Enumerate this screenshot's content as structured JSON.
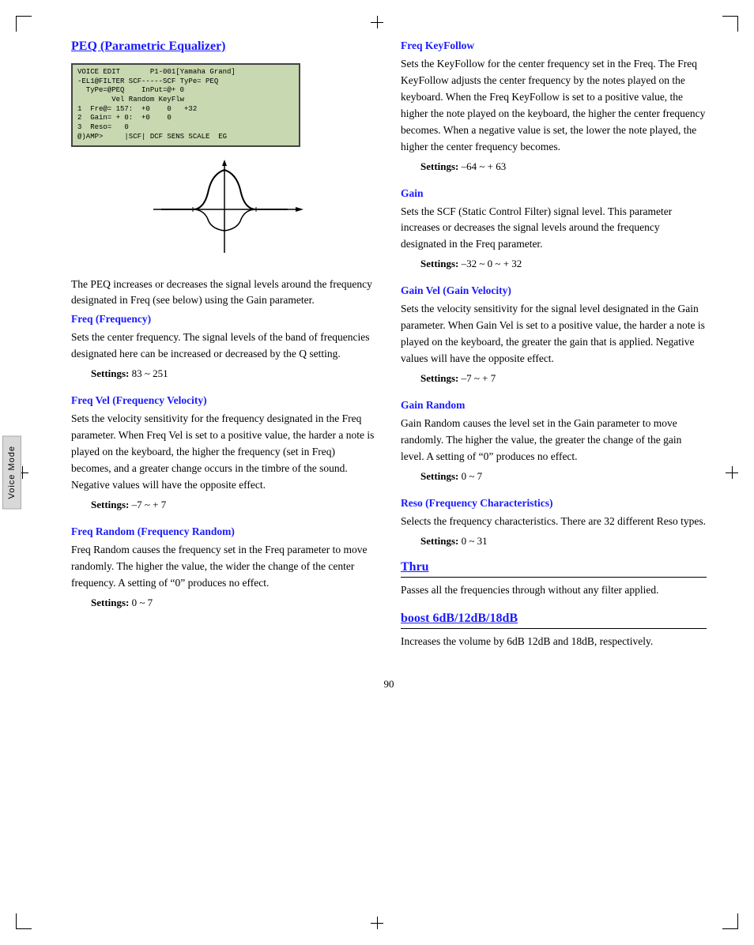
{
  "page": {
    "number": "90",
    "side_tab_label": "Voice Mode"
  },
  "left_column": {
    "section_title": "PEQ (Parametric Equalizer)",
    "lcd": {
      "lines": [
        "VOICE EDIT       P1-001[Yamaha Grand]",
        "-EL1@FILTER SCF-----SCF TyPe= PEQ   ",
        "  TyPe=@PEQ    InPut=@+ 0            ",
        "        Vel Random KeyFlw            ",
        "1 Fre@= 157:  +0    0   +32          ",
        "2 Gain= + 0:  +0    0                ",
        "3 Reso=  0                           ",
        "@)AMP>     |SCF| DCF SENS SCALE  EG  "
      ]
    },
    "intro_text": "The PEQ increases or decreases the signal levels around the frequency designated in Freq (see below) using the Gain parameter.",
    "freq": {
      "heading": "Freq (Frequency)",
      "body": "Sets the center frequency. The signal levels of the band of frequencies designated here can be increased or decreased by the Q setting.",
      "settings_label": "Settings:",
      "settings_value": "83 ~ 251"
    },
    "freq_vel": {
      "heading": "Freq Vel (Frequency Velocity)",
      "body": "Sets the velocity sensitivity for the frequency designated in the Freq parameter. When Freq Vel is set to a positive value, the harder a note is played on the keyboard, the higher the frequency (set in Freq) becomes, and a greater change occurs in the timbre of the sound. Negative values will have the opposite effect.",
      "settings_label": "Settings:",
      "settings_value": "–7 ~ + 7"
    },
    "freq_random": {
      "heading": "Freq Random (Frequency Random)",
      "body": "Freq Random causes the frequency set in the Freq parameter to move randomly. The higher the value, the wider the change of the center frequency. A setting of “0” produces no effect.",
      "settings_label": "Settings:",
      "settings_value": "0 ~ 7"
    }
  },
  "right_column": {
    "freq_keyfollow": {
      "heading": "Freq KeyFollow",
      "body": "Sets the KeyFollow for the center frequency set in the Freq. The Freq KeyFollow adjusts the center frequency by the notes played on the keyboard. When the Freq KeyFollow is set to a positive value, the higher the note played on the keyboard, the higher the center frequency becomes. When a negative value is set, the lower the note played, the higher the center frequency becomes.",
      "settings_label": "Settings:",
      "settings_value": "–64 ~  + 63"
    },
    "gain": {
      "heading": "Gain",
      "body": "Sets the SCF (Static Control Filter) signal level. This parameter increases or decreases the signal levels around the frequency designated in the Freq parameter.",
      "settings_label": "Settings:",
      "settings_value": "–32 ~ 0 ~  + 32"
    },
    "gain_vel": {
      "heading": "Gain Vel (Gain Velocity)",
      "body": "Sets the velocity sensitivity for the signal level designated in the Gain parameter. When Gain Vel is set to a positive value, the harder a note is played on the keyboard, the greater the gain that is applied. Negative values will have the opposite effect.",
      "settings_label": "Settings:",
      "settings_value": "–7 ~  + 7"
    },
    "gain_random": {
      "heading": "Gain Random",
      "body": "Gain Random causes the level set in the Gain parameter to move randomly. The higher the value, the greater the change of the gain level. A setting of “0” produces no effect.",
      "settings_label": "Settings:",
      "settings_value": "0 ~ 7"
    },
    "reso": {
      "heading": "Reso (Frequency Characteristics)",
      "body": "Selects the frequency characteristics. There are 32 different Reso types.",
      "settings_label": "Settings:",
      "settings_value": "0 ~ 31"
    },
    "thru": {
      "heading": "Thru",
      "body": "Passes all the frequencies through without any filter applied."
    },
    "boost": {
      "heading": "boost 6dB/12dB/18dB",
      "body": "Increases the volume by 6dB 12dB and 18dB, respectively."
    }
  }
}
